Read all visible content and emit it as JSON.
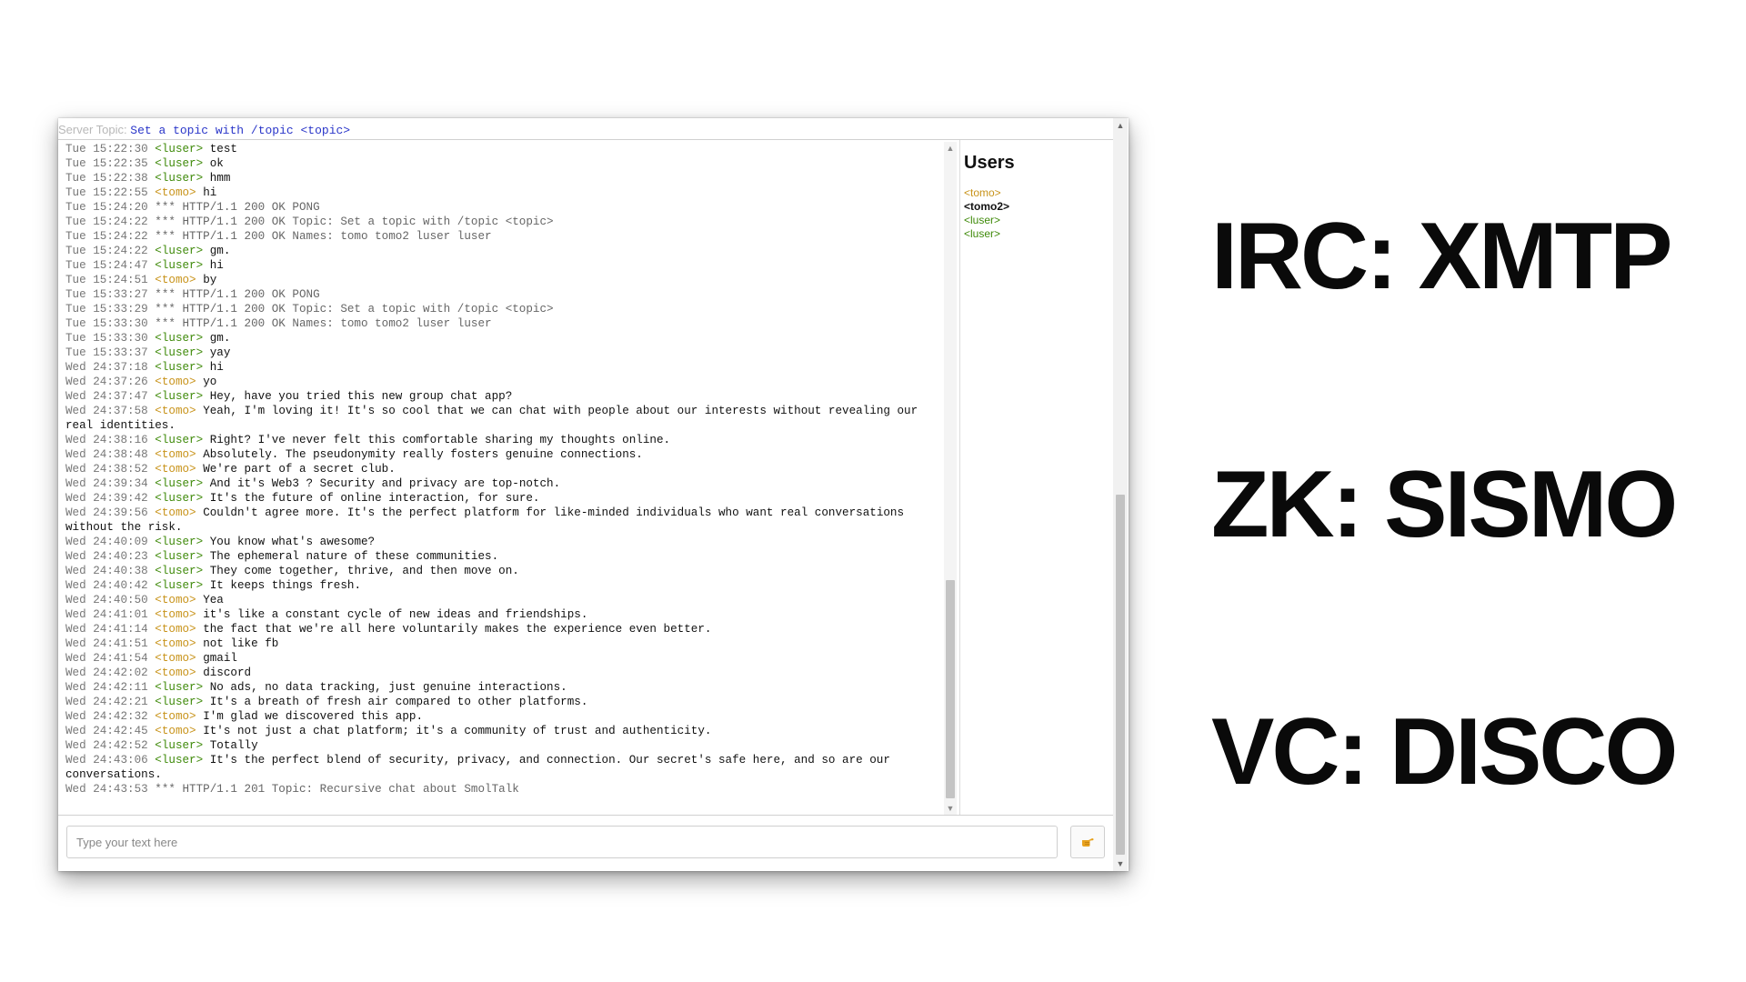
{
  "topic_bar": {
    "label": "Server Topic:",
    "value": "Set a topic with /topic <topic>"
  },
  "messages": [
    {
      "time": "Tue 15:22:30",
      "kind": "msg",
      "nick": "<luser>",
      "nick_class": "luser",
      "text": "test"
    },
    {
      "time": "Tue 15:22:35",
      "kind": "msg",
      "nick": "<luser>",
      "nick_class": "luser",
      "text": "ok"
    },
    {
      "time": "Tue 15:22:38",
      "kind": "msg",
      "nick": "<luser>",
      "nick_class": "luser",
      "text": "hmm"
    },
    {
      "time": "Tue 15:22:55",
      "kind": "msg",
      "nick": "<tomo>",
      "nick_class": "tomo",
      "text": "hi"
    },
    {
      "time": "Tue 15:24:20",
      "kind": "sys",
      "text": "*** HTTP/1.1 200 OK PONG"
    },
    {
      "time": "Tue 15:24:22",
      "kind": "sys",
      "text": "*** HTTP/1.1 200 OK Topic: Set a topic with /topic <topic>"
    },
    {
      "time": "Tue 15:24:22",
      "kind": "sys",
      "text": "*** HTTP/1.1 200 OK Names: tomo tomo2 luser luser"
    },
    {
      "time": "Tue 15:24:22",
      "kind": "msg",
      "nick": "<luser>",
      "nick_class": "luser",
      "text": "gm."
    },
    {
      "time": "Tue 15:24:47",
      "kind": "msg",
      "nick": "<luser>",
      "nick_class": "luser",
      "text": "hi"
    },
    {
      "time": "Tue 15:24:51",
      "kind": "msg",
      "nick": "<tomo>",
      "nick_class": "tomo",
      "text": "by"
    },
    {
      "time": "Tue 15:33:27",
      "kind": "sys",
      "text": "*** HTTP/1.1 200 OK PONG"
    },
    {
      "time": "Tue 15:33:29",
      "kind": "sys",
      "text": "*** HTTP/1.1 200 OK Topic: Set a topic with /topic <topic>"
    },
    {
      "time": "Tue 15:33:30",
      "kind": "sys",
      "text": "*** HTTP/1.1 200 OK Names: tomo tomo2 luser luser"
    },
    {
      "time": "Tue 15:33:30",
      "kind": "msg",
      "nick": "<luser>",
      "nick_class": "luser",
      "text": "gm."
    },
    {
      "time": "Tue 15:33:37",
      "kind": "msg",
      "nick": "<luser>",
      "nick_class": "luser",
      "text": "yay"
    },
    {
      "time": "Wed 24:37:18",
      "kind": "msg",
      "nick": "<luser>",
      "nick_class": "luser",
      "text": "hi"
    },
    {
      "time": "Wed 24:37:26",
      "kind": "msg",
      "nick": "<tomo>",
      "nick_class": "tomo",
      "text": "yo"
    },
    {
      "time": "Wed 24:37:47",
      "kind": "msg",
      "nick": "<luser>",
      "nick_class": "luser",
      "text": "Hey, have you tried this new group chat app?"
    },
    {
      "time": "Wed 24:37:58",
      "kind": "msg",
      "nick": "<tomo>",
      "nick_class": "tomo",
      "text": "Yeah, I'm loving it! It's so cool that we can chat with people about our interests without revealing our real identities."
    },
    {
      "time": "Wed 24:38:16",
      "kind": "msg",
      "nick": "<luser>",
      "nick_class": "luser",
      "text": "Right? I've never felt this comfortable sharing my thoughts online."
    },
    {
      "time": "Wed 24:38:48",
      "kind": "msg",
      "nick": "<tomo>",
      "nick_class": "tomo",
      "text": "Absolutely. The pseudonymity really fosters genuine connections."
    },
    {
      "time": "Wed 24:38:52",
      "kind": "msg",
      "nick": "<tomo>",
      "nick_class": "tomo",
      "text": "We're part of a secret club."
    },
    {
      "time": "Wed 24:39:34",
      "kind": "msg",
      "nick": "<luser>",
      "nick_class": "luser",
      "text": "And it's Web3 ? Security and privacy are top-notch."
    },
    {
      "time": "Wed 24:39:42",
      "kind": "msg",
      "nick": "<luser>",
      "nick_class": "luser",
      "text": "It's the future of online interaction, for sure."
    },
    {
      "time": "Wed 24:39:56",
      "kind": "msg",
      "nick": "<tomo>",
      "nick_class": "tomo",
      "text": "Couldn't agree more. It's the perfect platform for like-minded individuals who want real conversations without the risk."
    },
    {
      "time": "Wed 24:40:09",
      "kind": "msg",
      "nick": "<luser>",
      "nick_class": "luser",
      "text": "You know what's awesome?"
    },
    {
      "time": "Wed 24:40:23",
      "kind": "msg",
      "nick": "<luser>",
      "nick_class": "luser",
      "text": "The ephemeral nature of these communities."
    },
    {
      "time": "Wed 24:40:38",
      "kind": "msg",
      "nick": "<luser>",
      "nick_class": "luser",
      "text": "They come together, thrive, and then move on."
    },
    {
      "time": "Wed 24:40:42",
      "kind": "msg",
      "nick": "<luser>",
      "nick_class": "luser",
      "text": "It keeps things fresh."
    },
    {
      "time": "Wed 24:40:50",
      "kind": "msg",
      "nick": "<tomo>",
      "nick_class": "tomo",
      "text": "Yea"
    },
    {
      "time": "Wed 24:41:01",
      "kind": "msg",
      "nick": "<tomo>",
      "nick_class": "tomo",
      "text": "it's like a constant cycle of new ideas and friendships."
    },
    {
      "time": "Wed 24:41:14",
      "kind": "msg",
      "nick": "<tomo>",
      "nick_class": "tomo",
      "text": "the fact that we're all here voluntarily makes the experience even better."
    },
    {
      "time": "Wed 24:41:51",
      "kind": "msg",
      "nick": "<tomo>",
      "nick_class": "tomo",
      "text": "not like fb"
    },
    {
      "time": "Wed 24:41:54",
      "kind": "msg",
      "nick": "<tomo>",
      "nick_class": "tomo",
      "text": "gmail"
    },
    {
      "time": "Wed 24:42:02",
      "kind": "msg",
      "nick": "<tomo>",
      "nick_class": "tomo",
      "text": "discord"
    },
    {
      "time": "Wed 24:42:11",
      "kind": "msg",
      "nick": "<luser>",
      "nick_class": "luser",
      "text": "No ads, no data tracking, just genuine interactions."
    },
    {
      "time": "Wed 24:42:21",
      "kind": "msg",
      "nick": "<luser>",
      "nick_class": "luser",
      "text": "It's a breath of fresh air compared to other platforms."
    },
    {
      "time": "Wed 24:42:32",
      "kind": "msg",
      "nick": "<tomo>",
      "nick_class": "tomo",
      "text": "I'm glad we discovered this app."
    },
    {
      "time": "Wed 24:42:45",
      "kind": "msg",
      "nick": "<tomo>",
      "nick_class": "tomo",
      "text": "It's not just a chat platform; it's a community of trust and authenticity."
    },
    {
      "time": "Wed 24:42:52",
      "kind": "msg",
      "nick": "<luser>",
      "nick_class": "luser",
      "text": "Totally"
    },
    {
      "time": "Wed 24:43:06",
      "kind": "msg",
      "nick": "<luser>",
      "nick_class": "luser",
      "text": "It's the perfect blend of security, privacy, and connection. Our secret's safe here, and so are our conversations."
    },
    {
      "time": "Wed 24:43:53",
      "kind": "sys",
      "text": "*** HTTP/1.1 201 Topic: Recursive chat about SmolTalk"
    }
  ],
  "user_panel": {
    "title": "Users",
    "users": [
      {
        "name": "<tomo>",
        "style": "tomo"
      },
      {
        "name": "<tomo2>",
        "style": "self"
      },
      {
        "name": "<luser>",
        "style": "luser"
      },
      {
        "name": "<luser>",
        "style": "luser"
      }
    ]
  },
  "input": {
    "placeholder": "Type your text here",
    "value": ""
  },
  "send_button": {
    "icon": "pointing-hand-icon"
  },
  "slide": {
    "lines": [
      "IRC: XMTP",
      "ZK: SISMO",
      "VC: DISCO"
    ]
  },
  "colors": {
    "nick_luser": "#3f8a0a",
    "nick_tomo": "#c8931a",
    "topic_value": "#2a36c9",
    "send_icon": "#e8a21e"
  }
}
